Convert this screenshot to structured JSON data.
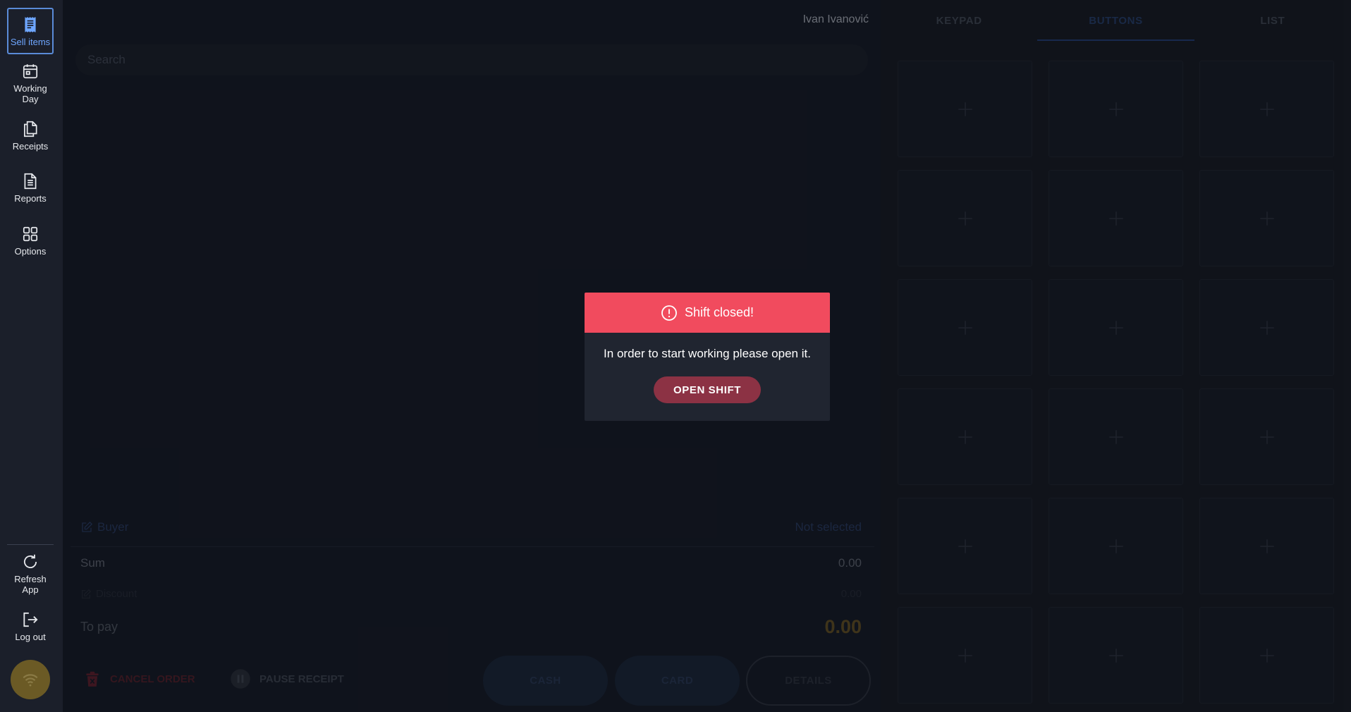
{
  "sidebar": {
    "items": [
      {
        "label": "Sell items",
        "icon": "receipt-icon",
        "active": true
      },
      {
        "label": "Working Day",
        "icon": "calendar-icon"
      },
      {
        "label": "Receipts",
        "icon": "documents-icon"
      },
      {
        "label": "Reports",
        "icon": "report-icon"
      },
      {
        "label": "Options",
        "icon": "grid-icon"
      }
    ],
    "bottom": [
      {
        "label": "Refresh App",
        "icon": "refresh-icon"
      },
      {
        "label": "Log out",
        "icon": "logout-icon"
      }
    ],
    "status_icon": "wifi-icon"
  },
  "header": {
    "user_name": "Ivan Ivanović"
  },
  "search": {
    "placeholder": "Search"
  },
  "order": {
    "buyer_label": "Buyer",
    "buyer_value": "Not selected",
    "sum_label": "Sum",
    "sum_value": "0.00",
    "discount_label": "Discount",
    "discount_value": "0.00",
    "to_pay_label": "To pay",
    "to_pay_value": "0.00"
  },
  "actions": {
    "cancel_order": "CANCEL ORDER",
    "pause_receipt": "PAUSE RECEIPT",
    "cash": "CASH",
    "card": "CARD",
    "details": "DETAILS"
  },
  "tabs": {
    "keypad": "KEYPAD",
    "buttons": "BUTTONS",
    "list": "LIST",
    "active": "BUTTONS"
  },
  "modal": {
    "title": "Shift closed!",
    "message": "In order to start working please open it.",
    "button": "OPEN SHIFT"
  },
  "colors": {
    "accent": "#6ea6ff",
    "modal_header": "#f14b5e",
    "open_shift_button": "#8c3244"
  }
}
